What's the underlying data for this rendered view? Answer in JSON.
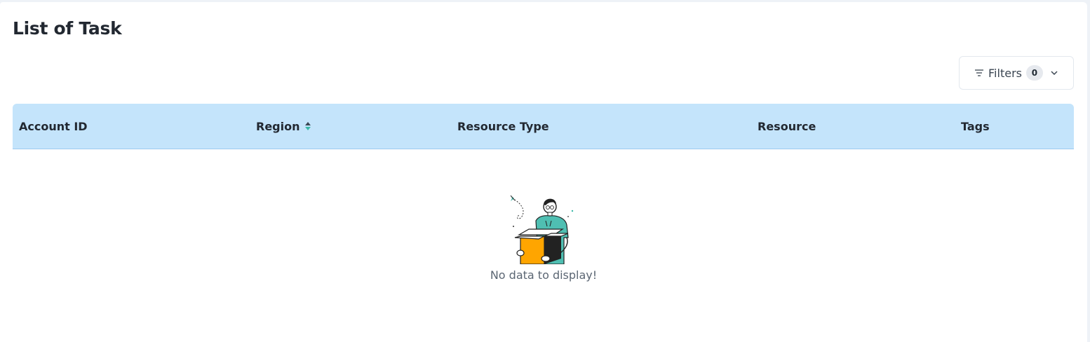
{
  "page": {
    "title": "List of Task"
  },
  "filters": {
    "label": "Filters",
    "count": "0",
    "icon": "filter-lines-icon",
    "chevron_icon": "chevron-down-icon"
  },
  "table": {
    "columns": [
      {
        "label": "Account ID"
      },
      {
        "label": "Region",
        "sort_icon": "sort-icon",
        "sortable": true
      },
      {
        "label": "Resource Type"
      },
      {
        "label": "Resource"
      },
      {
        "label": "Tags"
      }
    ],
    "rows": [],
    "empty_message": "No data to display!",
    "empty_illustration": "person-with-empty-box-illustration"
  },
  "colors": {
    "header_bg": "#c4e4fb",
    "accent": "#3ab8a8",
    "box_orange": "#ffa500"
  }
}
